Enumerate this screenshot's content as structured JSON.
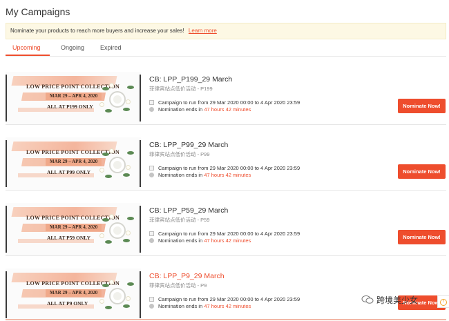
{
  "page": {
    "title": "My Campaigns"
  },
  "notice": {
    "text": "Nominate your products to reach more buyers and increase your sales!",
    "link": "Learn more"
  },
  "tabs": [
    {
      "label": "Upcoming",
      "active": true
    },
    {
      "label": "Ongoing",
      "active": false
    },
    {
      "label": "Expired",
      "active": false
    }
  ],
  "banner": {
    "collection": "LOW PRICE POINT COLLECTION",
    "dates": "MAR 29 – APR 4, 2020"
  },
  "campaigns": [
    {
      "title": "CB: LPP_P199_29 March",
      "subtitle": "菲律宾站点低价活动 - P199",
      "banner_price": "ALL AT P199 ONLY",
      "period": "Campaign to run from 29 Mar 2020 00:00 to 4 Apr 2020 23:59",
      "nomination_prefix": "Nomination ends in",
      "nomination_time": "47 hours 42 minutes",
      "button": "Nominate Now!"
    },
    {
      "title": "CB: LPP_P99_29 March",
      "subtitle": "菲律宾站点低价活动 - P99",
      "banner_price": "ALL AT P99 ONLY",
      "period": "Campaign to run from 29 Mar 2020 00:00 to 4 Apr 2020 23:59",
      "nomination_prefix": "Nomination ends in",
      "nomination_time": "47 hours 42 minutes",
      "button": "Nominate Now!"
    },
    {
      "title": "CB: LPP_P59_29 March",
      "subtitle": "菲律宾站点低价活动 - P59",
      "banner_price": "ALL AT P59 ONLY",
      "period": "Campaign to run from 29 Mar 2020 00:00 to 4 Apr 2020 23:59",
      "nomination_prefix": "Nomination ends in",
      "nomination_time": "47 hours 42 minutes",
      "button": "Nominate Now!"
    },
    {
      "title": "CB: LPP_P9_29 March",
      "subtitle": "菲律宾站点低价活动 - P9",
      "banner_price": "ALL AT P9 ONLY",
      "period": "Campaign to run from 29 Mar 2020 00:00 to 4 Apr 2020 23:59",
      "nomination_prefix": "Nomination ends in",
      "nomination_time": "47 hours 42 minutes",
      "button": "Nominate Now!"
    }
  ],
  "watermark": {
    "text": "跨境美少女"
  },
  "colors": {
    "accent": "#ee4d2d",
    "notice_bg": "#fdf8e4"
  }
}
